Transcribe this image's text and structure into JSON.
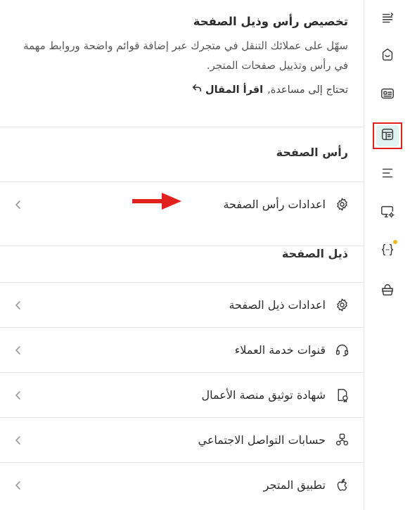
{
  "header": {
    "title": "تخصيص رأس وذيل الصفحة",
    "description": "سهّل على عملائك التنقل في متجرك عبر إضافة قوائم واضحة وروابط مهمة في رأس وتذييل صفحات المتجر.",
    "help_text": "تحتاج إلى مساعدة,",
    "help_link": "اقرأ المقال"
  },
  "sections": {
    "header_section": {
      "title": "رأس الصفحة",
      "items": [
        {
          "label": "اعدادات رأس الصفحة",
          "icon": "gear-icon"
        }
      ]
    },
    "footer_section": {
      "title": "ذيل الصفحة",
      "items": [
        {
          "label": "اعدادات ذيل الصفحة",
          "icon": "gear-icon"
        },
        {
          "label": "قنوات خدمة العملاء",
          "icon": "headset-icon"
        },
        {
          "label": "شهادة توثيق منصة الأعمال",
          "icon": "certificate-icon"
        },
        {
          "label": "حسابات التواصل الاجتماعي",
          "icon": "social-icon"
        },
        {
          "label": "تطبيق المتجر",
          "icon": "apple-icon"
        }
      ]
    }
  },
  "rail": {
    "items": [
      {
        "icon": "menu-collapse-icon"
      },
      {
        "icon": "smile-bag-icon"
      },
      {
        "icon": "id-card-icon"
      },
      {
        "icon": "layout-icon",
        "active": true
      },
      {
        "icon": "menu-lines-icon"
      },
      {
        "icon": "monitor-gear-icon"
      },
      {
        "icon": "code-braces-icon",
        "badge": true
      },
      {
        "icon": "basket-icon"
      }
    ]
  },
  "colors": {
    "accent_highlight": "#dff4f1",
    "annotation_red": "#e0211e",
    "badge": "#f6b624"
  }
}
